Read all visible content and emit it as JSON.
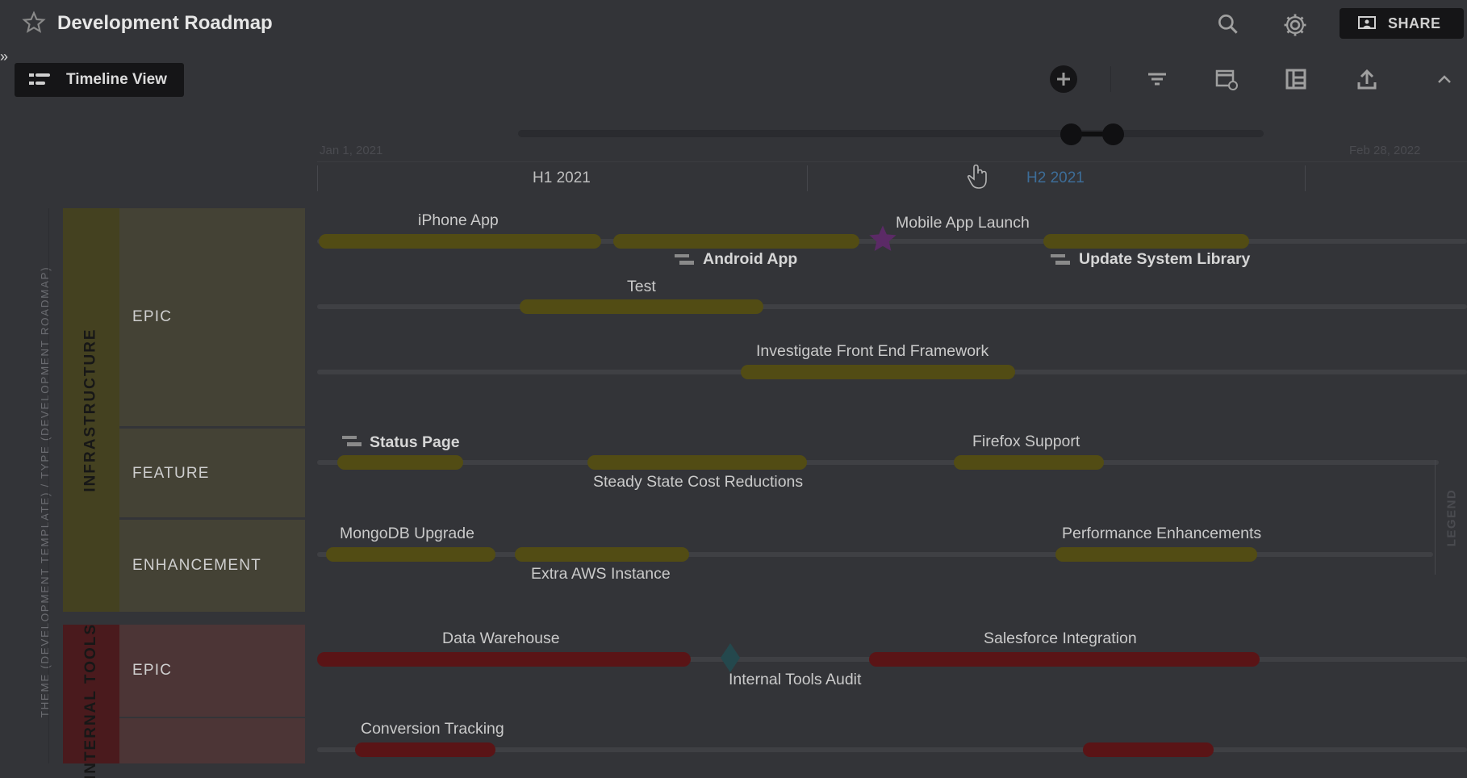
{
  "header": {
    "title": "Development Roadmap",
    "share_label": "SHARE"
  },
  "view": {
    "label": "Timeline View"
  },
  "timeline": {
    "start_date": "Jan 1, 2021",
    "end_date": "Feb 28, 2022",
    "periods": [
      "H1 2021",
      "H2 2021"
    ]
  },
  "sidebar": {
    "vertical_label": "THEME (DEVELOPMENT TEMPLATE) / TYPE (DEVELOPMENT ROADMAP)",
    "groups": [
      {
        "name": "INFRASTRUCTURE",
        "rows": [
          "EPIC",
          "FEATURE",
          "ENHANCEMENT"
        ]
      },
      {
        "name": "INTERNAL TOOLS",
        "rows": [
          "EPIC"
        ]
      }
    ]
  },
  "bars": {
    "iphone_app": "iPhone App",
    "android_app": "Android App",
    "mobile_launch": "Mobile App Launch",
    "update_lib": "Update System Library",
    "test": "Test",
    "investigate": "Investigate Front End Framework",
    "status_page": "Status Page",
    "firefox": "Firefox Support",
    "steady_state": "Steady State Cost Reductions",
    "mongodb": "MongoDB Upgrade",
    "performance": "Performance Enhancements",
    "extra_aws": "Extra AWS Instance",
    "data_warehouse": "Data Warehouse",
    "salesforce": "Salesforce Integration",
    "internal_audit": "Internal Tools Audit",
    "conversion": "Conversion Tracking"
  },
  "legend": {
    "label": "LEGEND"
  },
  "colors": {
    "infrastructure": "#524c14",
    "internal_tools": "#5a1416",
    "milestone": "#5b2a66"
  }
}
